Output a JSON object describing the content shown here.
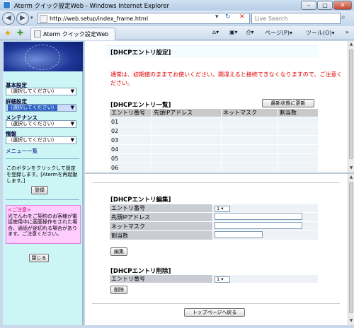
{
  "window": {
    "title": "Aterm クイック設定Web - Windows Internet Explorer",
    "min": "–",
    "max": "□",
    "close": "✕"
  },
  "address": {
    "url": "http://web.setup/index_frame.html",
    "search_placeholder": "Live Search"
  },
  "tab": {
    "label": "Aterm クイック設定Web"
  },
  "commands": {
    "page": "ページ(P)",
    "tools": "ツール(O)"
  },
  "sidebar": {
    "sections": [
      {
        "label": "基本設定",
        "select": "（選択してください）"
      },
      {
        "label": "詳細設定",
        "select": "（選択してください）"
      },
      {
        "label": "メンテナンス",
        "select": "（選択してください）"
      },
      {
        "label": "情報",
        "select": "（選択してください）"
      }
    ],
    "menu_list": "メニュー一覧",
    "register_note": "このボタンをクリックして設定を登録します。[Atermを再起動します。]",
    "register_button": "登録",
    "caution_title": "<ご注意>",
    "caution_text": "光でんわをご契約のお客様が電話使用中に画面操作をされた場合、通話が途切れる場合があります。ご注意ください。",
    "close_button": "閉じる"
  },
  "top": {
    "title": "[DHCPエントリ設定]",
    "warning": "通常は、初期値のままでお使いください。間違えると接続できなくなりますので、ご注意ください。",
    "list_title": "[DHCPエントリ一覧]",
    "refresh_button": "最新状態に更新",
    "columns": [
      "エントリ番号",
      "先頭IPアドレス",
      "ネットマスク",
      "割当数"
    ],
    "rows": [
      "01",
      "02",
      "03",
      "04",
      "05",
      "06"
    ]
  },
  "bottom": {
    "edit_title": "[DHCPエントリ編集]",
    "edit_fields": {
      "entry": "エントリ番号",
      "ip": "先頭IPアドレス",
      "mask": "ネットマスク",
      "count": "割当数"
    },
    "entry_value": "1",
    "edit_button": "編集",
    "delete_title": "[DHCPエントリ削除]",
    "delete_entry_label": "エントリ番号",
    "delete_entry_value": "1",
    "delete_button": "削除",
    "top_button": "トップページへ戻る"
  }
}
